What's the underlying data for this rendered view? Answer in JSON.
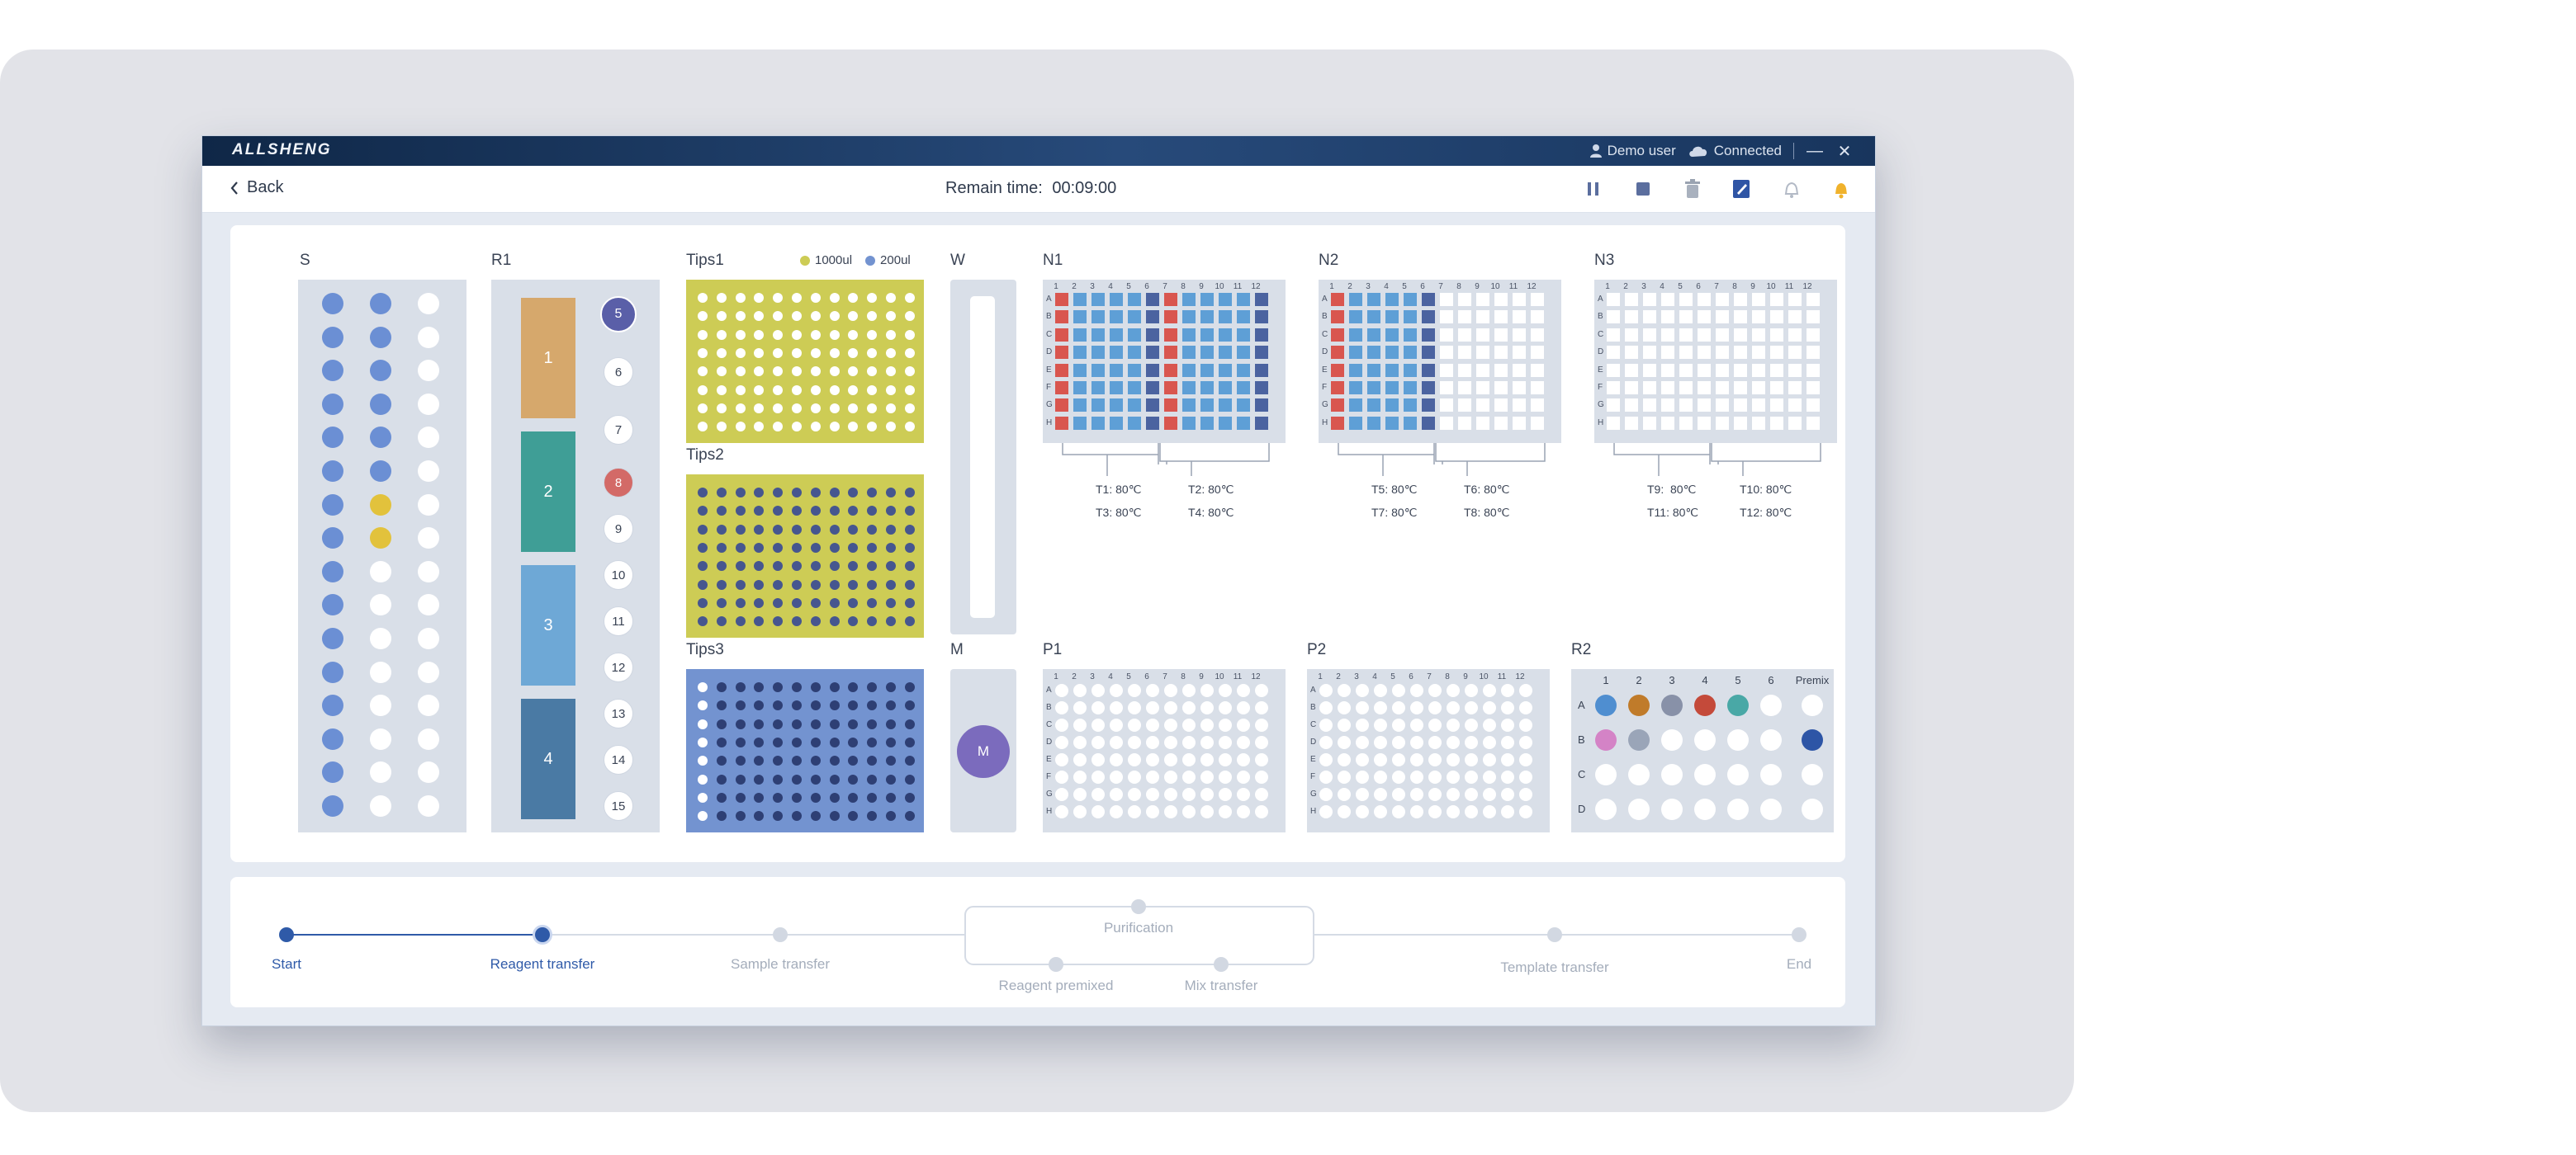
{
  "app": {
    "brand": "ALLSHENG",
    "user": "Demo user",
    "connection": "Connected",
    "user_icon": "user-icon",
    "cloud_icon": "cloud-icon"
  },
  "toolbar": {
    "back_label": "Back",
    "remain_label": "Remain time:",
    "remain_value": "00:09:00",
    "tools": [
      "pause-icon",
      "stop-icon",
      "trash-icon",
      "edit-icon",
      "bell-outline-icon",
      "bell-filled-icon"
    ]
  },
  "colors": {
    "blue": "#6b8fd4",
    "yellow": "#e2c23c",
    "tips_yellow": "#cdcc55",
    "tips_blue": "#7393d0",
    "well_light": "#5e9fd6",
    "well_dark": "#4b63a0",
    "well_red": "#d9564f",
    "purple": "#7b6bbd"
  },
  "deck": {
    "S": {
      "label": "S",
      "columns": [
        {
          "count": 16,
          "blue": 16,
          "yellow": []
        },
        {
          "count": 16,
          "blue": 6,
          "yellow": [
            6,
            7
          ]
        },
        {
          "count": 16,
          "blue": 0,
          "yellow": []
        }
      ]
    },
    "R1": {
      "label": "R1",
      "troughs": [
        {
          "label": "1",
          "color": "#d6a86c"
        },
        {
          "label": "2",
          "color": "#3f9e96"
        },
        {
          "label": "3",
          "color": "#6ea8d6"
        },
        {
          "label": "4",
          "color": "#4a7aa4"
        }
      ],
      "tubes": [
        {
          "label": "5",
          "fill": "#5a5fa8"
        },
        {
          "label": "6",
          "fill": "#ffffff"
        },
        {
          "label": "7",
          "fill": "#ffffff"
        },
        {
          "label": "8",
          "fill": "#d36a67"
        },
        {
          "label": "9",
          "fill": "#ffffff"
        },
        {
          "label": "10",
          "fill": "#ffffff"
        },
        {
          "label": "11",
          "fill": "#ffffff"
        },
        {
          "label": "12",
          "fill": "#ffffff"
        },
        {
          "label": "13",
          "fill": "#ffffff"
        },
        {
          "label": "14",
          "fill": "#ffffff"
        },
        {
          "label": "15",
          "fill": "#ffffff"
        }
      ]
    },
    "tips": {
      "legend": [
        {
          "label": "1000ul",
          "color": "#cdcc55"
        },
        {
          "label": "200ul",
          "color": "#7393d0"
        }
      ],
      "racks": [
        {
          "label": "Tips1",
          "bg": "#cdcc55",
          "dot": "#ffffff",
          "empty_cols": 0
        },
        {
          "label": "Tips2",
          "bg": "#cdcc55",
          "dot": "#46568f",
          "empty_cols": 0
        },
        {
          "label": "Tips3",
          "bg": "#7393d0",
          "dot": "#2e3f74",
          "empty_cols": 1
        }
      ]
    },
    "W": {
      "label": "W"
    },
    "M": {
      "label": "M",
      "content": "M"
    },
    "plate_cols": [
      "1",
      "2",
      "3",
      "4",
      "5",
      "6",
      "7",
      "8",
      "9",
      "10",
      "11",
      "12"
    ],
    "plate_rows": [
      "A",
      "B",
      "C",
      "D",
      "E",
      "F",
      "G",
      "H"
    ],
    "N_plates": [
      {
        "label": "N1",
        "filled_cols": 12,
        "temps": [
          "T1: 80℃",
          "T2: 80℃",
          "T3: 80℃",
          "T4: 80℃"
        ]
      },
      {
        "label": "N2",
        "filled_cols": 6,
        "temps": [
          "T5: 80℃",
          "T6: 80℃",
          "T7: 80℃",
          "T8: 80℃"
        ]
      },
      {
        "label": "N3",
        "filled_cols": 0,
        "temps": [
          "T9:  80℃",
          "T10: 80℃",
          "T11: 80℃",
          "T12: 80℃"
        ]
      }
    ],
    "P_plates": [
      {
        "label": "P1"
      },
      {
        "label": "P2"
      }
    ],
    "R2": {
      "label": "R2",
      "cols": [
        "1",
        "2",
        "3",
        "4",
        "5",
        "6",
        "Premix"
      ],
      "rows": [
        {
          "label": "A",
          "fills": [
            "#4f8ed0",
            "#c07b2a",
            "#8891a8",
            "#c44a3a",
            "#49a8a6",
            "#ffffff",
            "#ffffff"
          ]
        },
        {
          "label": "B",
          "fills": [
            "#d483c6",
            "#9aa5b8",
            "#ffffff",
            "#ffffff",
            "#ffffff",
            "#ffffff",
            "#2d55a6"
          ]
        },
        {
          "label": "C",
          "fills": [
            "#ffffff",
            "#ffffff",
            "#ffffff",
            "#ffffff",
            "#ffffff",
            "#ffffff",
            "#ffffff"
          ]
        },
        {
          "label": "D",
          "fills": [
            "#ffffff",
            "#ffffff",
            "#ffffff",
            "#ffffff",
            "#ffffff",
            "#ffffff",
            "#ffffff"
          ]
        }
      ]
    }
  },
  "progress": {
    "steps": [
      {
        "label": "Start",
        "state": "done"
      },
      {
        "label": "Reagent transfer",
        "state": "current"
      },
      {
        "label": "Sample transfer",
        "state": "pending"
      },
      {
        "label": "Purification",
        "state": "pending"
      },
      {
        "label": "Reagent premixed",
        "state": "pending"
      },
      {
        "label": "Mix transfer",
        "state": "pending"
      },
      {
        "label": "Template transfer",
        "state": "pending"
      },
      {
        "label": "End",
        "state": "pending"
      }
    ]
  }
}
